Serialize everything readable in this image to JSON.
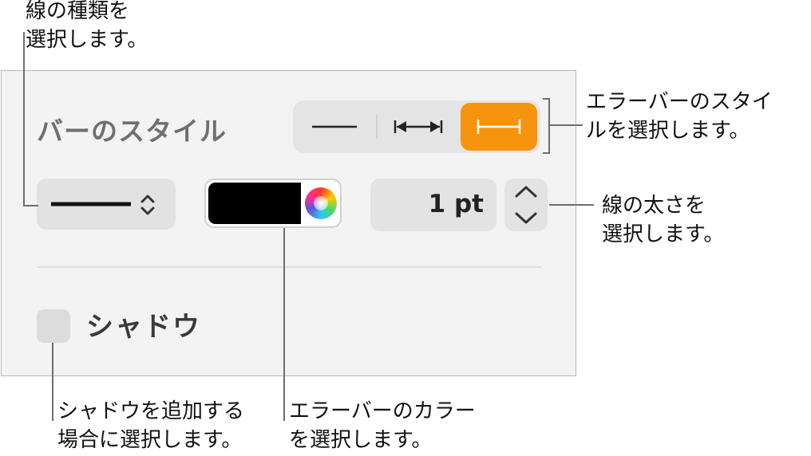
{
  "callouts": {
    "line_type": "線の種類を\n選択します。",
    "bar_style": "エラーバーのスタイ\nルを選択します。",
    "line_width": "線の太さを\n選択します。",
    "shadow": "シャドウを追加する\n場合に選択します。",
    "color": "エラーバーのカラー\nを選択します。"
  },
  "panel": {
    "bar_style_label": "バーのスタイル",
    "width_value": "1 pt",
    "shadow_label": "シャドウ",
    "shadow_checked": false,
    "selected_style": "capped"
  },
  "colors": {
    "accent": "#f7940d",
    "line_color": "#000000"
  },
  "icons": {
    "style_options": [
      "plain-line-icon",
      "arrow-ends-line-icon",
      "capped-line-icon"
    ],
    "popup": "chevron-updown-icon",
    "stepper_up": "chevron-up-icon",
    "stepper_down": "chevron-down-icon",
    "color_picker": "color-wheel-icon"
  }
}
